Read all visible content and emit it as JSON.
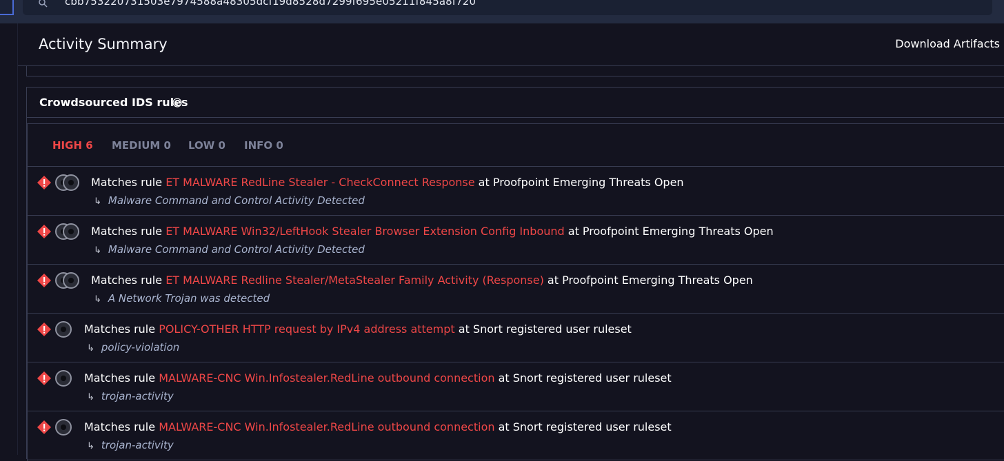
{
  "search": {
    "value": "cbb753220731503e7974588a48305dcf19d8528d7299f695e05211f845a8f720"
  },
  "header": {
    "title": "Activity Summary",
    "download_label": "Download Artifacts"
  },
  "ids": {
    "title": "Crowdsourced IDS rules",
    "tabs": [
      {
        "label": "HIGH 6",
        "active": true
      },
      {
        "label": "MEDIUM 0",
        "active": false
      },
      {
        "label": "LOW 0",
        "active": false
      },
      {
        "label": "INFO 0",
        "active": false
      }
    ],
    "match_prefix": "Matches rule",
    "at_word": "at",
    "rules": [
      {
        "name": "ET MALWARE RedLine Stealer - CheckConnect Response",
        "source": "Proofpoint Emerging Threats Open",
        "description": "Malware Command and Control Activity Detected",
        "avatar_count": 2
      },
      {
        "name": "ET MALWARE Win32/LeftHook Stealer Browser Extension Config Inbound",
        "source": "Proofpoint Emerging Threats Open",
        "description": "Malware Command and Control Activity Detected",
        "avatar_count": 2
      },
      {
        "name": "ET MALWARE Redline Stealer/MetaStealer Family Activity (Response)",
        "source": "Proofpoint Emerging Threats Open",
        "description": "A Network Trojan was detected",
        "avatar_count": 2
      },
      {
        "name": "POLICY-OTHER HTTP request by IPv4 address attempt",
        "source": "Snort registered user ruleset",
        "description": "policy-violation",
        "avatar_count": 1
      },
      {
        "name": "MALWARE-CNC Win.Infostealer.RedLine outbound connection",
        "source": "Snort registered user ruleset",
        "description": "trojan-activity",
        "avatar_count": 1
      },
      {
        "name": "MALWARE-CNC Win.Infostealer.RedLine outbound connection",
        "source": "Snort registered user ruleset",
        "description": "trojan-activity",
        "avatar_count": 1
      }
    ]
  },
  "colors": {
    "accent_red": "#ef4747",
    "background": "#13131f"
  },
  "icons": {
    "search": "search-icon",
    "info": "info-icon",
    "alert": "alert-icon"
  }
}
